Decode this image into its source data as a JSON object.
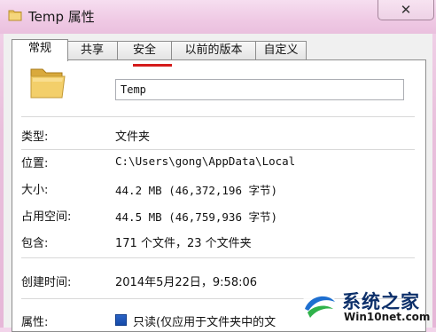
{
  "window": {
    "title": "Temp 属性",
    "close_glyph": "✕"
  },
  "tabs": [
    {
      "label": "常规",
      "active": true
    },
    {
      "label": "共享"
    },
    {
      "label": "安全"
    },
    {
      "label": "以前的版本"
    },
    {
      "label": "自定义"
    }
  ],
  "general": {
    "folder_name": "Temp",
    "rows": [
      {
        "label": "类型:",
        "value": "文件夹"
      },
      {
        "label": "位置:",
        "value": "C:\\Users\\gong\\AppData\\Local"
      },
      {
        "label": "大小:",
        "value": "44.2 MB (46,372,196 字节)"
      },
      {
        "label": "占用空间:",
        "value": "44.5 MB (46,759,936 字节)"
      },
      {
        "label": "包含:",
        "value": "171 个文件，23 个文件夹"
      },
      {
        "label": "创建时间:",
        "value": "2014年5月22日，9:58:06"
      }
    ],
    "attributes_label": "属性:",
    "readonly_text": "只读(仅应用于文件夹中的文",
    "readonly_checked": true
  },
  "watermark": {
    "brand": "系统之家",
    "site": "Win10net.com"
  },
  "icons": {
    "title_icon": "folder-icon",
    "big_icon": "folder-icon",
    "close": "close-icon"
  }
}
